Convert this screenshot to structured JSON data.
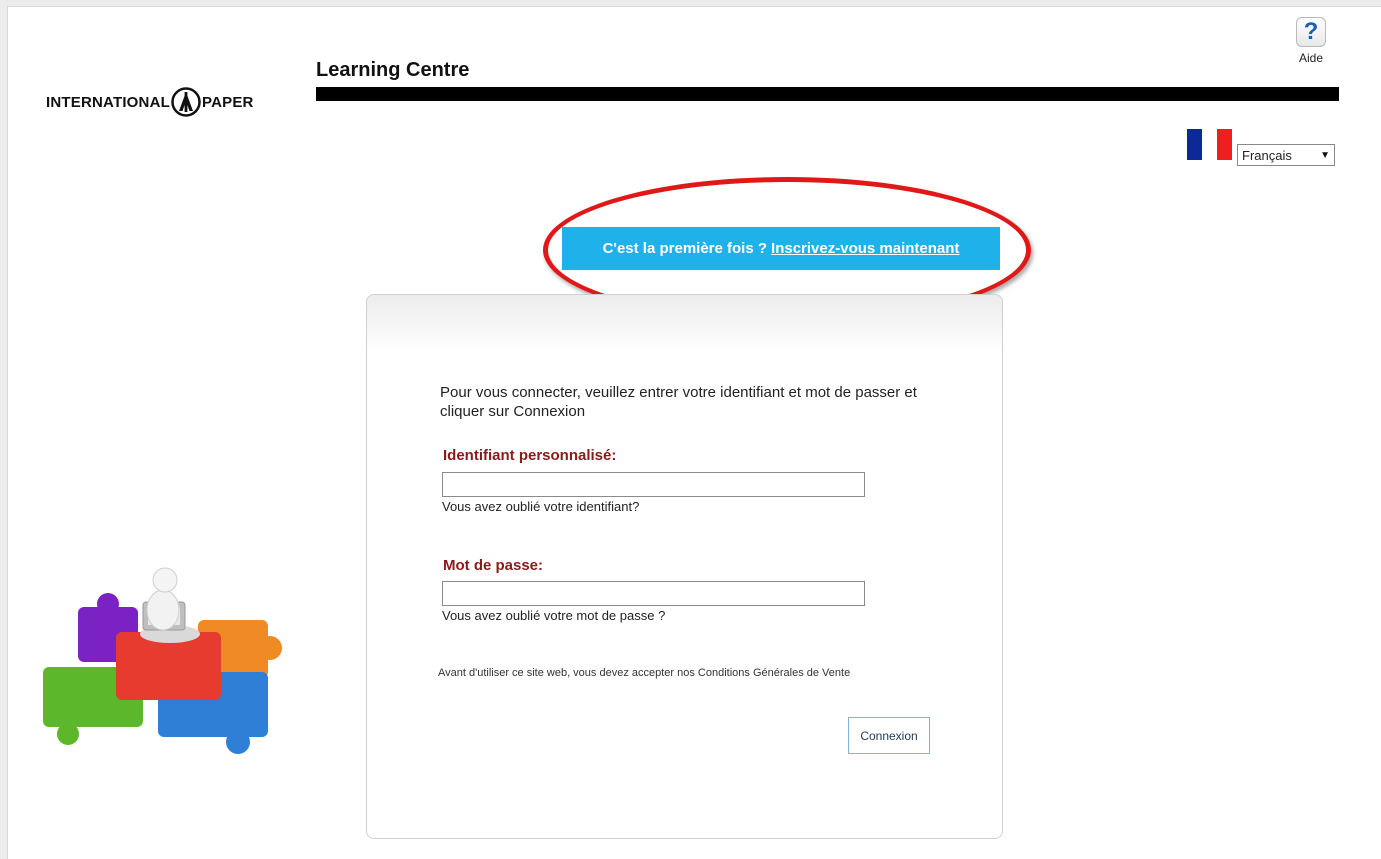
{
  "header": {
    "logo_left": "INTERNATIONAL",
    "logo_right": "PAPER",
    "app_title": "Learning Centre",
    "help_label": "Aide",
    "help_glyph": "?"
  },
  "language": {
    "flag_colors": [
      "#0b2a96",
      "#ffffff",
      "#f01e1e"
    ],
    "selected": "Français"
  },
  "signup": {
    "question": "C'est la première fois ?",
    "link": "Inscrivez-vous maintenant",
    "banner_color": "#1fb1ea",
    "highlight_color": "#e01818"
  },
  "login": {
    "intro": "Pour vous connecter, veuillez entrer votre identifiant et mot de passer et cliquer sur Connexion",
    "username_label": "Identifiant personnalisé:",
    "username_value": "",
    "forgot_username": "Vous avez oublié votre identifiant?",
    "password_label": "Mot de passe:",
    "password_value": "",
    "forgot_password": "Vous avez oublié votre mot de passe ?",
    "terms": "Avant d'utiliser ce site web, vous devez accepter nos Conditions Générales de Vente",
    "submit_label": "Connexion"
  },
  "illustration": {
    "icon": "puzzle-pieces-laptop-figure",
    "colors": [
      "#7a22c4",
      "#e63b2e",
      "#f08a24",
      "#5cb82a",
      "#2f7fd6"
    ]
  }
}
